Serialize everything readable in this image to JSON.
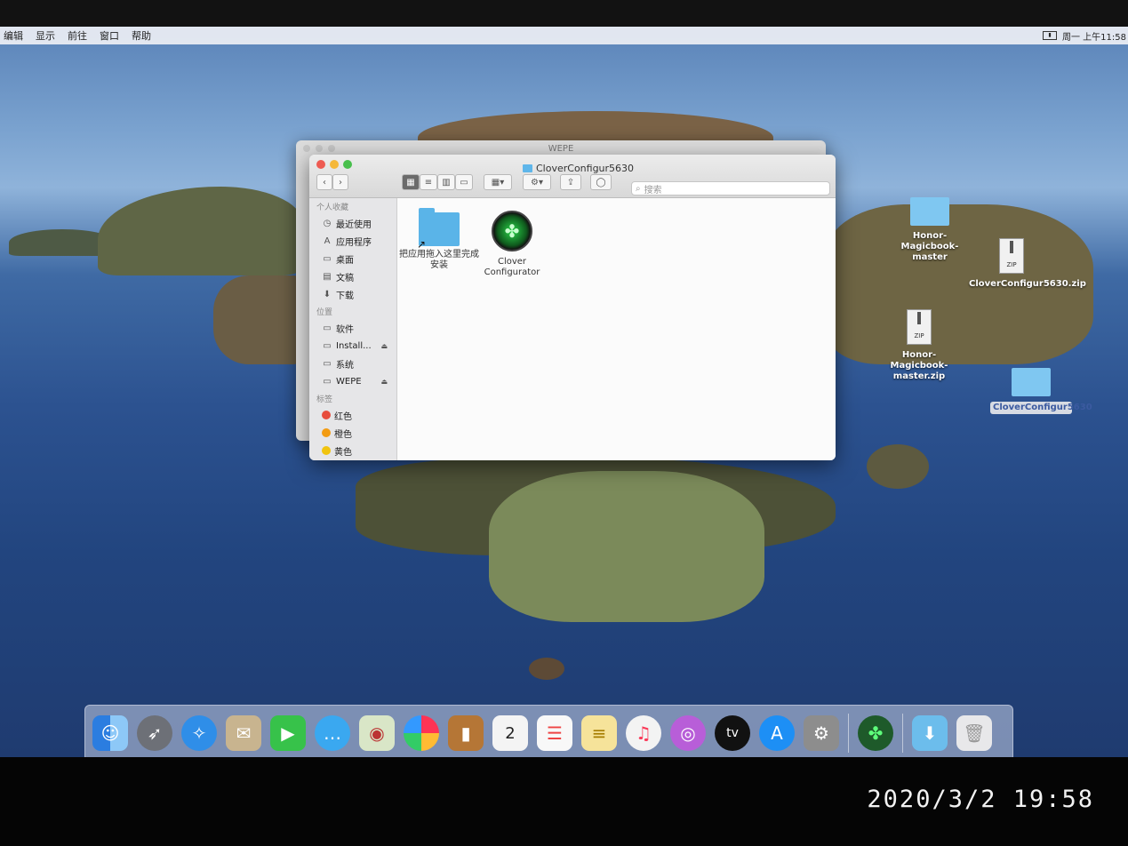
{
  "menubar": {
    "items": [
      "编辑",
      "显示",
      "前往",
      "窗口",
      "帮助"
    ],
    "clock": "周一 上午11:58"
  },
  "back_window": {
    "title": "WEPE"
  },
  "finder": {
    "title": "CloverConfigur5630",
    "search_placeholder": "搜索",
    "sidebar": {
      "favorites_header": "个人收藏",
      "favorites": [
        {
          "label": "最近使用",
          "icon": "recent-icon"
        },
        {
          "label": "应用程序",
          "icon": "applications-icon"
        },
        {
          "label": "桌面",
          "icon": "desktop-icon"
        },
        {
          "label": "文稿",
          "icon": "documents-icon"
        },
        {
          "label": "下载",
          "icon": "downloads-icon"
        }
      ],
      "locations_header": "位置",
      "locations": [
        {
          "label": "软件"
        },
        {
          "label": "Install..."
        },
        {
          "label": "系统"
        },
        {
          "label": "WEPE"
        }
      ],
      "tags_header": "标签",
      "tags": [
        {
          "label": "红色",
          "color": "#e74c3c"
        },
        {
          "label": "橙色",
          "color": "#f39c12"
        },
        {
          "label": "黄色",
          "color": "#f1c40f"
        }
      ]
    },
    "files": [
      {
        "label": "把应用拖入这里完成安装",
        "icon": "applications-folder-alias-icon"
      },
      {
        "label": "Clover Configurator",
        "icon": "clover-configurator-icon"
      }
    ]
  },
  "desktop": {
    "icons": [
      {
        "label": "Honor-Magicbook-master",
        "type": "folder"
      },
      {
        "label": "CloverConfigur5630.zip",
        "type": "zip"
      },
      {
        "label": "Honor-Magicbook-master.zip",
        "type": "zip"
      },
      {
        "label": "CloverConfigur5630",
        "type": "folder"
      }
    ],
    "zip_badge": "ZIP"
  },
  "dock": {
    "apps": [
      "finder-icon",
      "launchpad-icon",
      "safari-icon",
      "mail-icon",
      "facetime-icon",
      "messages-icon",
      "maps-icon",
      "photos-icon",
      "contacts-icon",
      "calendar-icon",
      "reminders-icon",
      "notes-icon",
      "music-icon",
      "podcasts-icon",
      "tv-icon",
      "app-store-icon",
      "system-preferences-icon",
      "clover-configurator-icon",
      "downloads-folder-icon",
      "trash-icon"
    ],
    "calendar_day": "2",
    "tv_label": "tv"
  },
  "photo_timestamp": "2020/3/2  19:58",
  "colors": {
    "desktop_ocean": "#2c5290",
    "folder_blue": "#5ab4e8",
    "selection": "#d7dbe3"
  }
}
